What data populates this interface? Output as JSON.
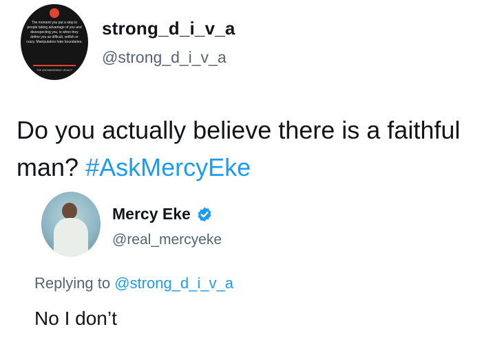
{
  "original_tweet": {
    "display_name": "strong_d_i_v_a",
    "handle": "@strong_d_i_v_a",
    "avatar_quote": "The moment you put a stop to people taking advantage of you and disrespecting you, is when they define you as difficult, selfish or crazy. Manipulators hate boundaries.",
    "avatar_caption": "THE UNCHANGEABLE LEGACY",
    "text": "Do you actually believe there is a faithful man?",
    "hashtag": "#AskMercyEke"
  },
  "reply_tweet": {
    "display_name": "Mercy Eke",
    "verified_icon": "verified-badge-icon",
    "handle": "@real_mercyeke",
    "replying_to_label": "Replying to",
    "replying_to_handle": "@strong_d_i_v_a",
    "text": "No I don’t"
  },
  "colors": {
    "link": "#1d9bf0",
    "secondary_text": "#536471",
    "primary_text": "#111418",
    "avatar_accent": "#e0452f"
  }
}
